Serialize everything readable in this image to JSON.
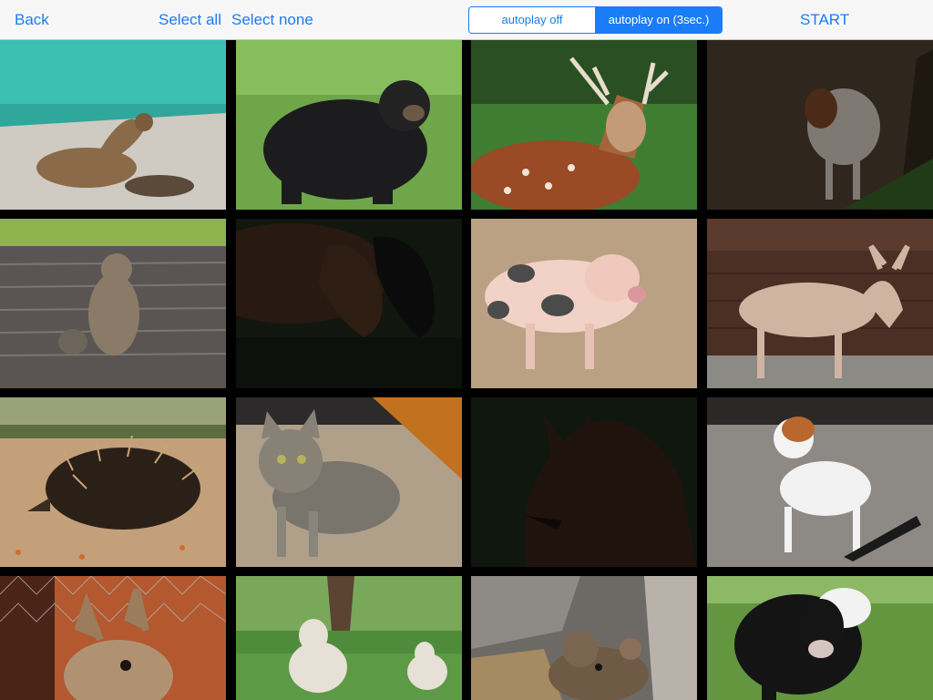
{
  "toolbar": {
    "back_label": "Back",
    "select_all_label": "Select all",
    "select_none_label": "Select none",
    "autoplay_off_label": "autoplay off",
    "autoplay_on_label": "autoplay on (3sec.)",
    "start_label": "START",
    "accent_color": "#1a7cf6"
  },
  "grid": {
    "columns": 4,
    "tiles": [
      {
        "animal": "sea-lion",
        "dimmed": false
      },
      {
        "animal": "bear",
        "dimmed": false
      },
      {
        "animal": "deer",
        "dimmed": false
      },
      {
        "animal": "goat",
        "dimmed": true
      },
      {
        "animal": "squirrel",
        "dimmed": false
      },
      {
        "animal": "horse",
        "dimmed": true
      },
      {
        "animal": "pig",
        "dimmed": false
      },
      {
        "animal": "donkey",
        "dimmed": false
      },
      {
        "animal": "echidna",
        "dimmed": false
      },
      {
        "animal": "cat",
        "dimmed": false
      },
      {
        "animal": "fox",
        "dimmed": true
      },
      {
        "animal": "dog",
        "dimmed": false
      },
      {
        "animal": "rabbit",
        "dimmed": false
      },
      {
        "animal": "sheep",
        "dimmed": false
      },
      {
        "animal": "mouse",
        "dimmed": false
      },
      {
        "animal": "cow",
        "dimmed": false
      }
    ]
  }
}
